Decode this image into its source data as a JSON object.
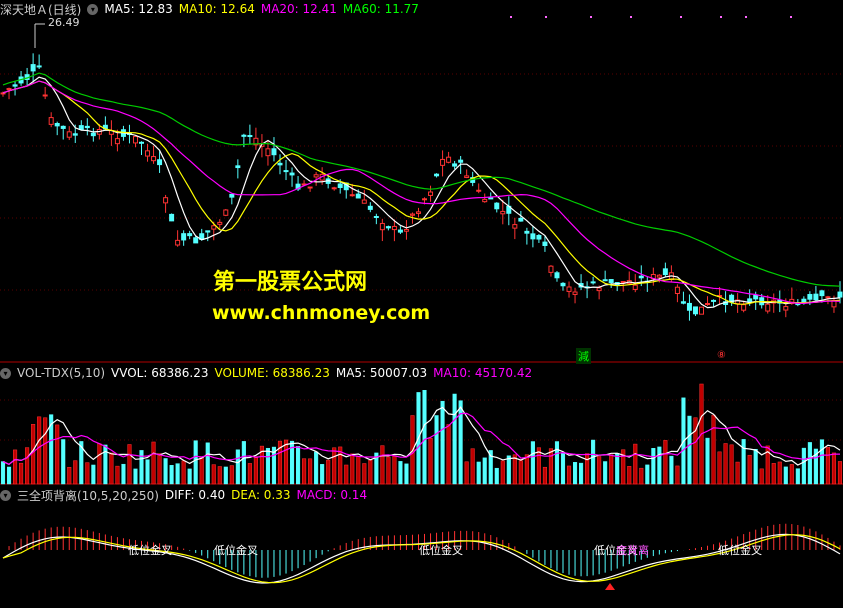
{
  "main": {
    "title": "深天地Ａ(日线)",
    "ma": [
      {
        "label": "MA5: 12.83",
        "color": "#ffffff"
      },
      {
        "label": "MA10: 12.64",
        "color": "#ffff00"
      },
      {
        "label": "MA20: 12.41",
        "color": "#ff00ff"
      },
      {
        "label": "MA60: 11.77",
        "color": "#00ff00"
      }
    ],
    "high_label": "26.49",
    "signal_jian": "減",
    "signal_marker": "⑧"
  },
  "watermark": {
    "line1": "第一股票公式网",
    "line2": "www.chnmoney.com"
  },
  "vol": {
    "title": "VOL-TDX(5,10)",
    "items": [
      {
        "label": "VVOL: 68386.23",
        "color": "#ffffff"
      },
      {
        "label": "VOLUME: 68386.23",
        "color": "#ffff00"
      },
      {
        "label": "MA5: 50007.03",
        "color": "#ffffff"
      },
      {
        "label": "MA10: 45170.42",
        "color": "#ff00ff"
      }
    ]
  },
  "macd": {
    "title": "三全项背离(10,5,20,250)",
    "items": [
      {
        "label": "DIFF: 0.40",
        "color": "#ffffff"
      },
      {
        "label": "DEA: 0.33",
        "color": "#ffff00"
      },
      {
        "label": "MACD: 0.14",
        "color": "#ff00ff"
      }
    ],
    "signals": [
      "低位金叉",
      "低位金叉",
      "低位金叉",
      "低位金叉",
      "低位金叉"
    ],
    "pink_signal": "底背离"
  },
  "colors": {
    "up": "#ff3333",
    "down": "#54ffff",
    "ma60": "#00cc00",
    "ma20": "#ff00ff"
  }
}
